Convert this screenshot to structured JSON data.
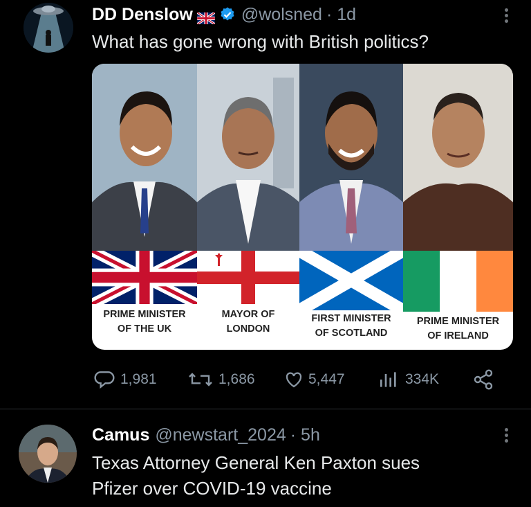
{
  "tweet1": {
    "display_name": "DD Denslow",
    "handle": "@wolsned",
    "time": "· 1d",
    "text": "What has gone wrong with British politics?",
    "captions": [
      [
        "PRIME MINISTER",
        "OF THE UK"
      ],
      [
        "MAYOR OF",
        "LONDON"
      ],
      [
        "FIRST MINISTER",
        "OF SCOTLAND"
      ],
      [
        "PRIME MINISTER",
        "OF IRELAND"
      ]
    ],
    "stats": {
      "replies": "1,981",
      "reposts": "1,686",
      "likes": "5,447",
      "views": "334K"
    }
  },
  "tweet2": {
    "display_name": "Camus",
    "handle": "@newstart_2024",
    "time": "· 5h",
    "text_line1": "Texas Attorney General Ken Paxton sues",
    "text_line2": "Pfizer over COVID-19 vaccine"
  },
  "colors": {
    "background": "#000000",
    "verified": "#1d9bf0",
    "secondary_text": "#8b98a5",
    "divider": "#2f3336"
  }
}
